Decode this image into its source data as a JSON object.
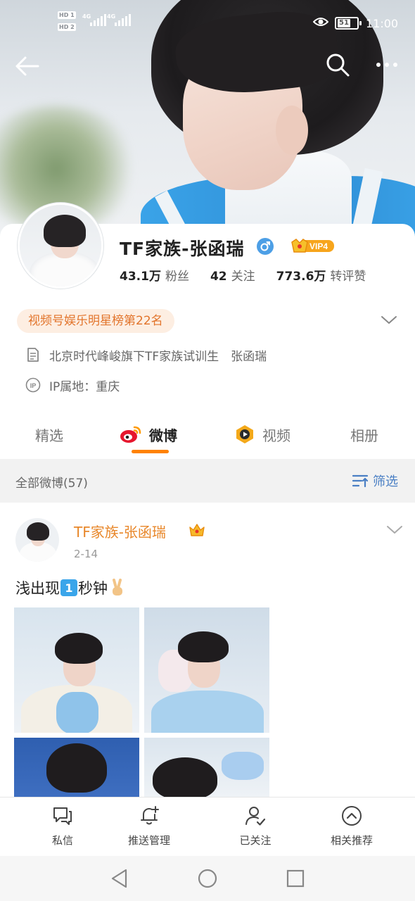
{
  "status_bar": {
    "sim1": "HD 1",
    "sim2": "HD 2",
    "net1": "4G",
    "net2": "4G",
    "battery": "51",
    "time": "11:00"
  },
  "profile": {
    "username": "TF家族-张函瑞",
    "vip": "VIP4",
    "followers_count": "43.1万",
    "followers_label": "粉丝",
    "following_count": "42",
    "following_label": "关注",
    "engagement_count": "773.6万",
    "engagement_label": "转评赞",
    "rank_badge": "视频号娱乐明星榜第22名",
    "bio": "北京时代峰峻旗下TF家族试训生　张函瑞",
    "ip_label": "IP属地：",
    "ip_value": "重庆"
  },
  "tabs": [
    {
      "label": "精选"
    },
    {
      "label": "微博",
      "active": true
    },
    {
      "label": "视频"
    },
    {
      "label": "相册"
    }
  ],
  "filter": {
    "count_label": "全部微博(57)",
    "filter_label": "筛选"
  },
  "post": {
    "author": "TF家族-张函瑞",
    "date": "2-14",
    "text_before": "浅出现",
    "number_emoji": "1",
    "text_after": "秒钟"
  },
  "actions": [
    {
      "label": "私信",
      "icon": "message-icon"
    },
    {
      "label": "推送管理",
      "icon": "bell-plus-icon"
    },
    {
      "label": "已关注",
      "icon": "user-check-icon"
    },
    {
      "label": "相关推荐",
      "icon": "chevron-up-circle-icon"
    }
  ],
  "colors": {
    "accent_orange": "#ff8200",
    "author_orange": "#e8872a",
    "filter_blue": "#4a7fc4",
    "male_blue": "#4d9fe6"
  }
}
